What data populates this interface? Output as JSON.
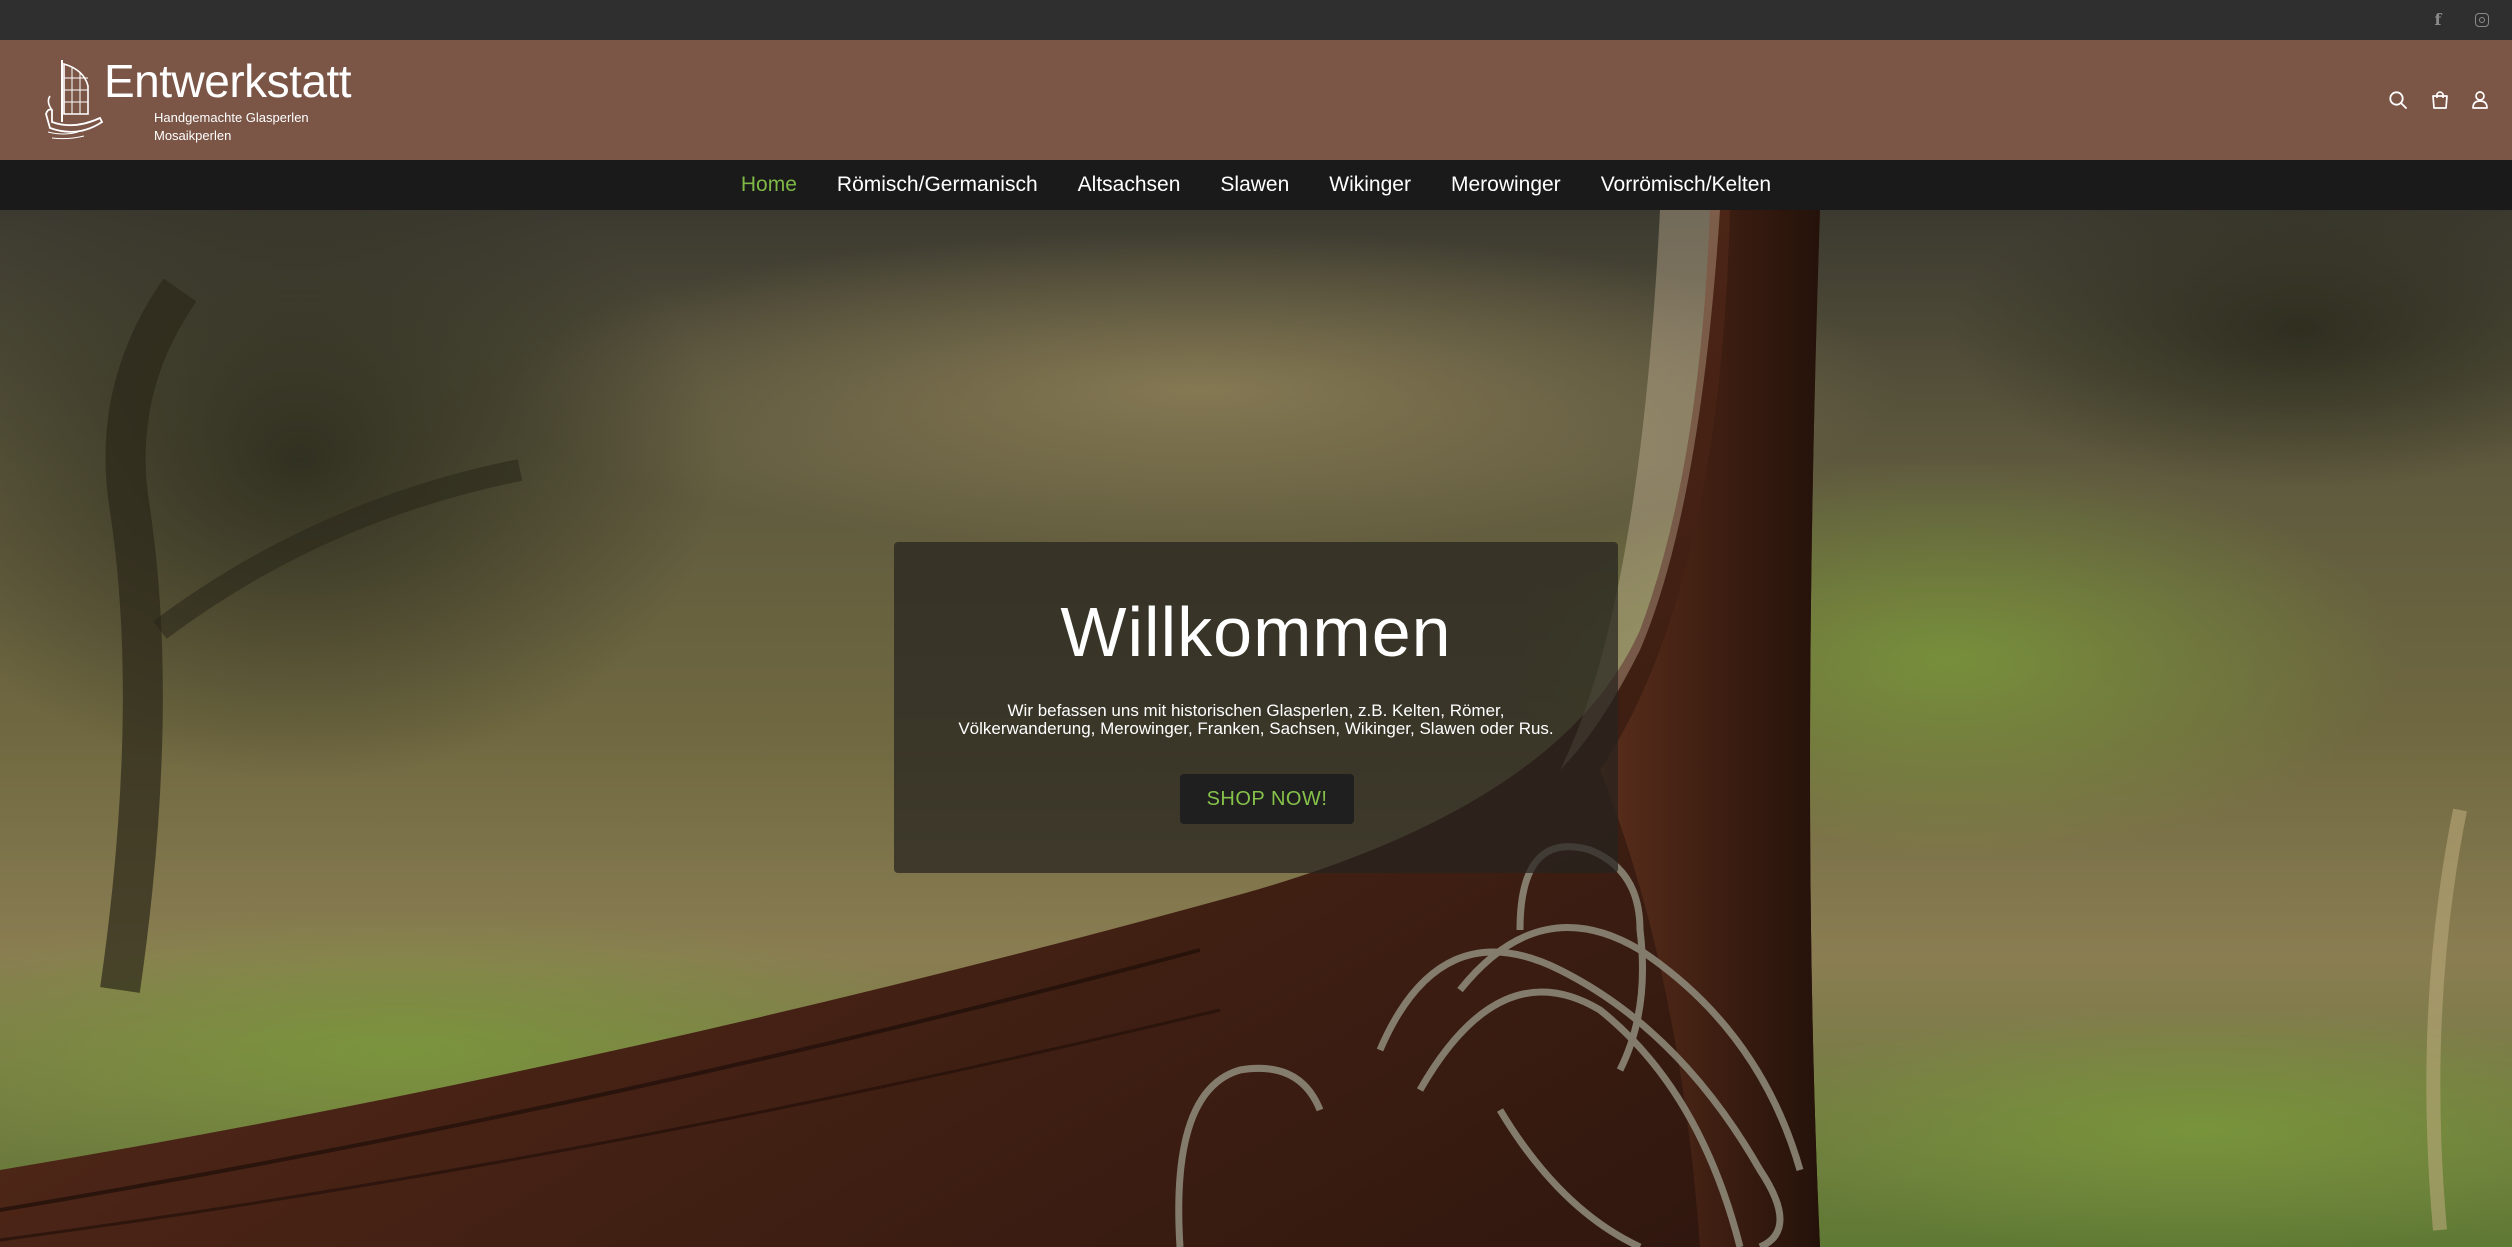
{
  "topbar": {
    "social": [
      {
        "name": "facebook-icon",
        "glyph": "f"
      },
      {
        "name": "instagram-icon",
        "glyph": ""
      }
    ]
  },
  "header": {
    "brand": {
      "title": "Entwerkstatt",
      "subtitle_1": "Handgemachte Glasperlen",
      "subtitle_2": "Mosaikperlen",
      "logo_icon": "viking-ship-icon"
    },
    "actions": [
      {
        "name": "search-icon"
      },
      {
        "name": "shopping-bag-icon"
      },
      {
        "name": "user-icon"
      }
    ],
    "background_color": "#7b5546"
  },
  "nav": {
    "items": [
      {
        "label": "Home",
        "active": true
      },
      {
        "label": "Römisch/Germanisch",
        "active": false
      },
      {
        "label": "Altsachsen",
        "active": false
      },
      {
        "label": "Slawen",
        "active": false
      },
      {
        "label": "Wikinger",
        "active": false
      },
      {
        "label": "Merowinger",
        "active": false
      },
      {
        "label": "Vorrömisch/Kelten",
        "active": false
      }
    ],
    "active_color": "#7fb846"
  },
  "hero": {
    "title": "Willkommen",
    "text": "Wir befassen uns mit historischen Glasperlen, z.B. Kelten, Römer, Völkerwanderung, Merowinger, Franken, Sachsen, Wikinger, Slawen oder Rus.",
    "cta_label": "SHOP NOW!",
    "cta_color": "#86c24a"
  }
}
